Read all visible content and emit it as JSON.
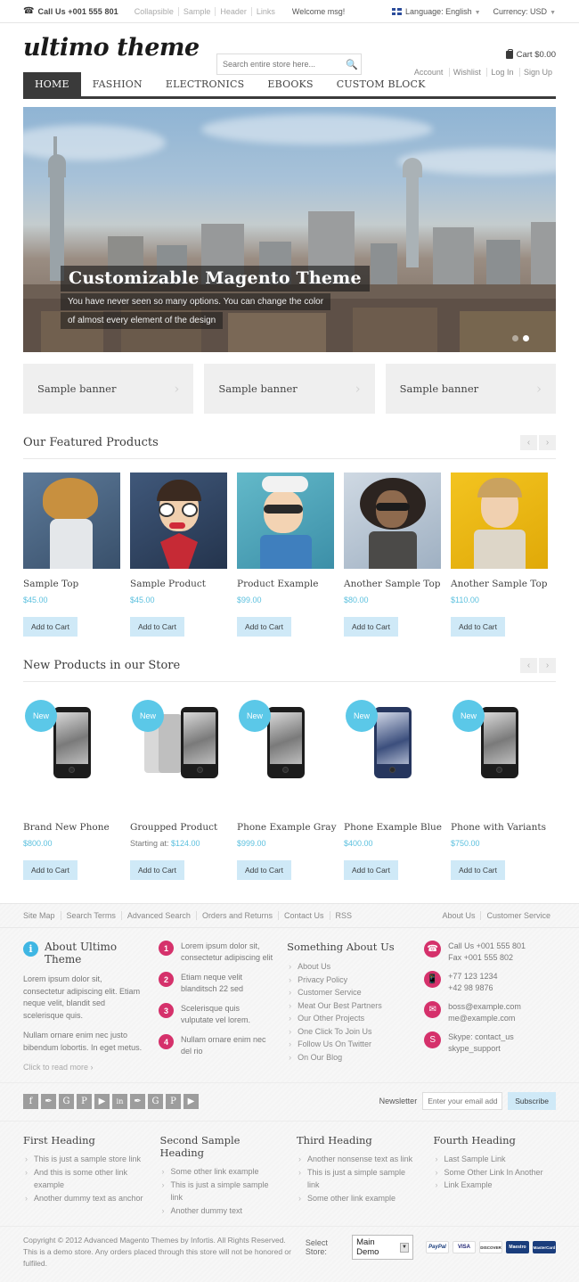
{
  "topbar": {
    "phone_icon": "phone-icon",
    "call_us": "Call Us +001 555 801",
    "links": [
      "Collapsible",
      "Sample",
      "Header",
      "Links"
    ],
    "welcome": "Welcome msg!",
    "language": "Language: English",
    "currency": "Currency: USD"
  },
  "header": {
    "logo": "ultimo theme",
    "search_placeholder": "Search entire store here...",
    "search_value": "",
    "cart": "Cart $0.00",
    "account_links": [
      "Account",
      "Wishlist",
      "Log In",
      "Sign Up"
    ]
  },
  "nav": {
    "items": [
      {
        "label": "HOME",
        "active": true
      },
      {
        "label": "FASHION",
        "active": false
      },
      {
        "label": "ELECTRONICS",
        "active": false
      },
      {
        "label": "EBOOKS",
        "active": false
      },
      {
        "label": "CUSTOM BLOCK",
        "active": false
      }
    ]
  },
  "slider": {
    "title": "Customizable Magento Theme",
    "sub1": "You have never seen so many options. You can change the color",
    "sub2": "of almost every element of the design",
    "dots": 2,
    "active_dot": 2
  },
  "banners": [
    {
      "label": "Sample banner"
    },
    {
      "label": "Sample banner"
    },
    {
      "label": "Sample banner"
    }
  ],
  "featured": {
    "title": "Our Featured Products",
    "prev": "‹",
    "next": "›",
    "products": [
      {
        "name": "Sample Top",
        "price": "$45.00",
        "button": "Add to Cart"
      },
      {
        "name": "Sample Product",
        "price": "$45.00",
        "button": "Add to Cart"
      },
      {
        "name": "Product Example",
        "price": "$99.00",
        "button": "Add to Cart"
      },
      {
        "name": "Another Sample Top",
        "price": "$80.00",
        "button": "Add to Cart"
      },
      {
        "name": "Another Sample Top",
        "price": "$110.00",
        "button": "Add to Cart"
      }
    ]
  },
  "newproducts": {
    "title": "New Products in our Store",
    "prev": "‹",
    "next": "›",
    "badge": "New",
    "products": [
      {
        "name": "Brand New Phone",
        "price_pre": "",
        "price": "$800.00",
        "button": "Add to Cart"
      },
      {
        "name": "Groupped Product",
        "price_pre": "Starting at: ",
        "price": "$124.00",
        "button": "Add to Cart"
      },
      {
        "name": "Phone Example Gray",
        "price_pre": "",
        "price": "$999.00",
        "button": "Add to Cart"
      },
      {
        "name": "Phone Example Blue",
        "price_pre": "",
        "price": "$400.00",
        "button": "Add to Cart"
      },
      {
        "name": "Phone with Variants",
        "price_pre": "",
        "price": "$750.00",
        "button": "Add to Cart"
      }
    ]
  },
  "footer": {
    "bar_left": [
      "Site Map",
      "Search Terms",
      "Advanced Search",
      "Orders and Returns",
      "Contact Us",
      "RSS"
    ],
    "bar_right": [
      "About Us",
      "Customer Service"
    ],
    "about": {
      "icon": "info-icon",
      "title": "About Ultimo Theme",
      "p1": "Lorem ipsum dolor sit, consectetur adipiscing elit. Etiam neque velit, blandit sed scelerisque quis.",
      "p2": "Nullam ornare enim nec justo bibendum lobortis. In eget metus.",
      "readmore": "Click to read more ›"
    },
    "numbered": [
      {
        "n": "1",
        "text": "Lorem ipsum dolor sit, consectetur adipiscing elit"
      },
      {
        "n": "2",
        "text": "Etiam neque velit blanditsch 22 sed"
      },
      {
        "n": "3",
        "text": "Scelerisque quis vulputate vel lorem."
      },
      {
        "n": "4",
        "text": "Nullam ornare enim nec del rio"
      }
    ],
    "about_us": {
      "heading": "Something About Us",
      "links": [
        "About Us",
        "Privacy Policy",
        "Customer Service",
        "Meat Our Best Partners",
        "Our Other Projects",
        "One Click To Join Us",
        "Follow Us On Twitter",
        "On Our Blog"
      ]
    },
    "contacts": [
      {
        "icon": "phone-icon",
        "l1": "Call Us +001 555 801",
        "l2": "Fax +001 555 802"
      },
      {
        "icon": "mobile-icon",
        "l1": "+77 123 1234",
        "l2": "+42 98 9876"
      },
      {
        "icon": "mail-icon",
        "l1": "boss@example.com",
        "l2": "me@example.com"
      },
      {
        "icon": "skype-icon",
        "l1": "Skype: contact_us",
        "l2": "skype_support"
      }
    ],
    "social": [
      {
        "name": "facebook-icon",
        "glyph": "f"
      },
      {
        "name": "twitter-icon",
        "glyph": "✒"
      },
      {
        "name": "googleplus-icon",
        "glyph": "G"
      },
      {
        "name": "pinterest-icon",
        "glyph": "P"
      },
      {
        "name": "youtube-icon",
        "glyph": "▶"
      },
      {
        "name": "linkedin-icon",
        "glyph": "in"
      },
      {
        "name": "twitter-icon",
        "glyph": "✒"
      },
      {
        "name": "googleplus-icon",
        "glyph": "G"
      },
      {
        "name": "pinterest-icon",
        "glyph": "P"
      },
      {
        "name": "youtube-icon",
        "glyph": "▶"
      }
    ],
    "newsletter": {
      "label": "Newsletter",
      "placeholder": "Enter your email add...",
      "value": "",
      "button": "Subscribe"
    },
    "link_columns": [
      {
        "heading": "First Heading",
        "links": [
          "This is just a sample store link",
          "And this is some other link example",
          "Another dummy text as anchor"
        ]
      },
      {
        "heading": "Second Sample Heading",
        "links": [
          "Some other link example",
          "This is just a simple sample link",
          "Another dummy text"
        ]
      },
      {
        "heading": "Third Heading",
        "links": [
          "Another nonsense text as link",
          "This is just a simple sample link",
          "Some other link example"
        ]
      },
      {
        "heading": "Fourth Heading",
        "links": [
          "Last Sample Link",
          "Some Other Link In Another",
          "Link Example"
        ]
      }
    ],
    "copyright_1": "Copyright © 2012 Advanced Magento Themes by Infortis. All Rights Reserved.",
    "copyright_2": "This is a demo store. Any orders placed through this store will not be honored or fulfiled.",
    "select_store_label": "Select Store:",
    "select_store_value": "Main Demo",
    "cards": [
      {
        "name": "paypal",
        "label": "PayPal",
        "bg": "#ffffff",
        "fg": "#1a3d7c"
      },
      {
        "name": "visa",
        "label": "VISA",
        "bg": "#ffffff",
        "fg": "#1a1f71"
      },
      {
        "name": "discover",
        "label": "DISCOVER",
        "bg": "#ffffff",
        "fg": "#333333"
      },
      {
        "name": "maestro",
        "label": "Maestro",
        "bg": "#1a3d7c",
        "fg": "#ffffff"
      },
      {
        "name": "mastercard",
        "label": "MasterCard",
        "bg": "#1a3d7c",
        "fg": "#ffffff"
      }
    ]
  },
  "colors": {
    "accent_cyan": "#5bc8e8",
    "price_cyan": "#5bc0de",
    "button_blue": "#cfe9f7",
    "pink": "#d5316b",
    "nav_dark": "#3a3a3a"
  }
}
